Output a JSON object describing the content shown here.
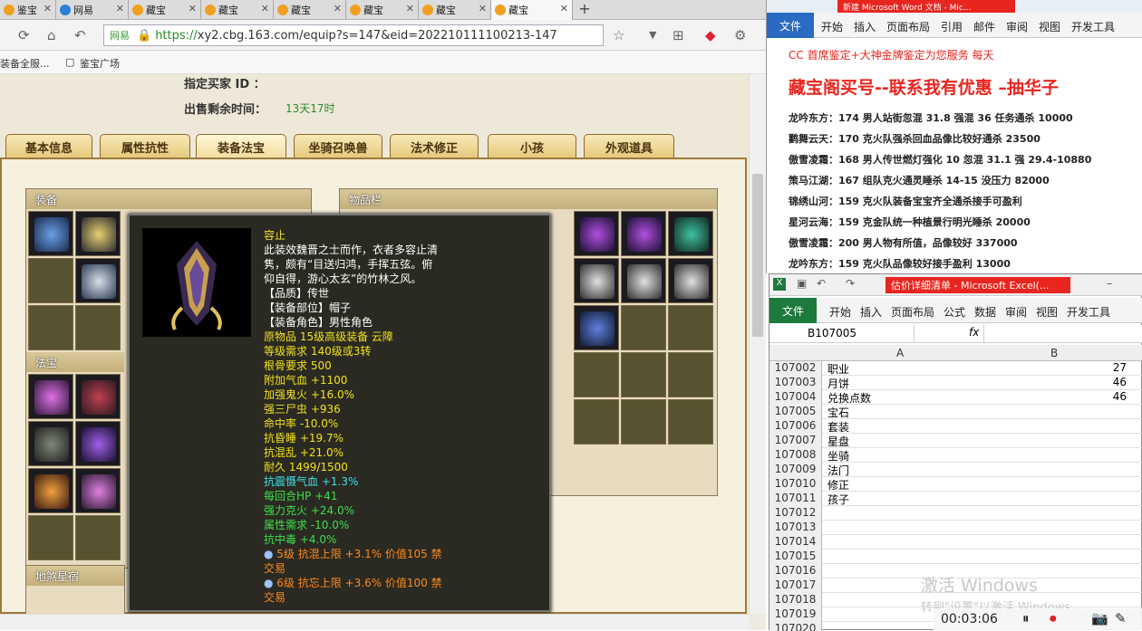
{
  "browser": {
    "tabs": [
      {
        "label": "鉴宝"
      },
      {
        "label": "网易"
      },
      {
        "label": "藏宝"
      },
      {
        "label": "藏宝"
      },
      {
        "label": "藏宝"
      },
      {
        "label": "藏宝"
      },
      {
        "label": "藏宝"
      },
      {
        "label": "藏宝"
      }
    ],
    "url_site": "网易",
    "url_https": "https://",
    "url_rest": "xy2.cbg.163.com/equip?s=147&eid=202210111100213-147",
    "bookmarks": [
      "装备全服...",
      "鉴宝广场"
    ]
  },
  "page": {
    "seller_label": "指定买家 ID ：",
    "time_label": "出售剩余时间：",
    "time_value": "13天17时",
    "tabs": [
      "基本信息",
      "属性抗性",
      "装备法宝",
      "坐骑召唤兽",
      "法术修正",
      "小孩",
      "外观道具"
    ],
    "equip_title": "装备",
    "fabao_title": "法宝",
    "dizhu_title": "地煞星宿",
    "items_title": "物品栏"
  },
  "tooltip": {
    "lines": [
      {
        "text": "容止",
        "color": "#f2e21e"
      },
      {
        "text": "此装效魏晋之士而作，衣者多容止清",
        "color": "#ffffff"
      },
      {
        "text": "隽，颇有“目送归鸿，手挥五弦。俯",
        "color": "#ffffff"
      },
      {
        "text": "仰自得，游心太玄”的竹林之风。",
        "color": "#ffffff"
      },
      {
        "text": "【品质】传世",
        "color": "#ffffff"
      },
      {
        "text": "【装备部位】帽子",
        "color": "#ffffff"
      },
      {
        "text": "【装备角色】男性角色",
        "color": "#ffffff"
      },
      {
        "text": "原物品 15级高级装备 云障",
        "color": "#f2e21e"
      },
      {
        "text": "等级需求 140级或3转",
        "color": "#f2e21e"
      },
      {
        "text": "根骨要求 500",
        "color": "#f2e21e"
      },
      {
        "text": "附加气血 +1100",
        "color": "#f2e21e"
      },
      {
        "text": "加强鬼火 +16.0%",
        "color": "#f2e21e"
      },
      {
        "text": "强三尸虫 +936",
        "color": "#f2e21e"
      },
      {
        "text": "命中率 -10.0%",
        "color": "#f2e21e"
      },
      {
        "text": "抗昏睡 +19.7%",
        "color": "#f2e21e"
      },
      {
        "text": "抗混乱 +21.0%",
        "color": "#f2e21e"
      },
      {
        "text": "耐久 1499/1500",
        "color": "#f2e21e"
      },
      {
        "text": "抗震慑气血 +1.3%",
        "color": "#3ee0e8"
      },
      {
        "text": "每回合HP +41",
        "color": "#3fe04a"
      },
      {
        "text": "强力克火 +24.0%",
        "color": "#3fe04a"
      },
      {
        "text": "属性需求 -10.0%",
        "color": "#3fe04a"
      },
      {
        "text": "抗中毒 +4.0%",
        "color": "#3fe04a"
      },
      {
        "text": "5级 抗混上限 +3.1% 价值105 禁",
        "color": "#ff8a1e",
        "gem": true
      },
      {
        "text": "交易",
        "color": "#ff8a1e"
      },
      {
        "text": "6级 抗忘上限 +3.6% 价值100 禁",
        "color": "#ff8a1e",
        "gem": true
      },
      {
        "text": "交易",
        "color": "#ff8a1e"
      }
    ]
  },
  "word": {
    "title": "新建 Microsoft Word 文档 - Mic...",
    "file": "文件",
    "ribbon_tabs": [
      "开始",
      "插入",
      "页面布局",
      "引用",
      "邮件",
      "审阅",
      "视图",
      "开发工具"
    ],
    "header_line": "CC 首席鉴定+大神金牌鉴定为您服务 每天",
    "big_title": "藏宝阁买号--联系我有优惠 –抽华子",
    "lines": [
      "龙吟东方：174 男人站街忽混 31.8 强混 36 任务通杀 10000",
      "鹳舞云天：170 克火队强杀回血品像比较好通杀 23500",
      "傲雪凌霜：168 男人传世燃灯强化 10 忽混 31.1 强 29.4-10880",
      "策马江湖：167 组队克火通灵睡杀 14-15 没压力 82000",
      "锦绣山河：159 克火队装备宝宝齐全通杀接手可盈利",
      "星河云海：159 克金队统一种植景行明光睡杀 20000",
      "傲雪凌霜：200 男人物有所值，品像较好 337000",
      "龙吟东方：159 克火队品像较好接手盈利 13000"
    ]
  },
  "excel": {
    "title": "估价详细清单 - Microsoft Excel(...",
    "file": "文件",
    "ribbon_tabs": [
      "开始",
      "插入",
      "页面布局",
      "公式",
      "数据",
      "审阅",
      "视图",
      "开发工具"
    ],
    "namebox": "B107005",
    "fx": "fx",
    "col_a": "A",
    "col_b": "B",
    "rows": [
      {
        "n": "107002",
        "a": "职业",
        "b": "27"
      },
      {
        "n": "107003",
        "a": "月饼",
        "b": "46"
      },
      {
        "n": "107004",
        "a": "兑换点数",
        "b": "46"
      },
      {
        "n": "107005",
        "a": "宝石",
        "b": ""
      },
      {
        "n": "107006",
        "a": "套装",
        "b": ""
      },
      {
        "n": "107007",
        "a": "星盘",
        "b": ""
      },
      {
        "n": "107008",
        "a": "坐骑",
        "b": ""
      },
      {
        "n": "107009",
        "a": "法门",
        "b": ""
      },
      {
        "n": "107010",
        "a": "修正",
        "b": ""
      },
      {
        "n": "107011",
        "a": "孩子",
        "b": ""
      },
      {
        "n": "107012",
        "a": "",
        "b": ""
      },
      {
        "n": "107013",
        "a": "",
        "b": ""
      },
      {
        "n": "107014",
        "a": "",
        "b": ""
      },
      {
        "n": "107015",
        "a": "",
        "b": ""
      },
      {
        "n": "107016",
        "a": "",
        "b": ""
      },
      {
        "n": "107017",
        "a": "",
        "b": ""
      },
      {
        "n": "107018",
        "a": "",
        "b": ""
      },
      {
        "n": "107019",
        "a": "",
        "b": ""
      },
      {
        "n": "107020",
        "a": "",
        "b": ""
      }
    ]
  },
  "overlay": {
    "watermark": "激活 Windows",
    "watermark_sub": "转到\"设置\"以激活 Windows。",
    "rec_time": "00:03:06"
  }
}
